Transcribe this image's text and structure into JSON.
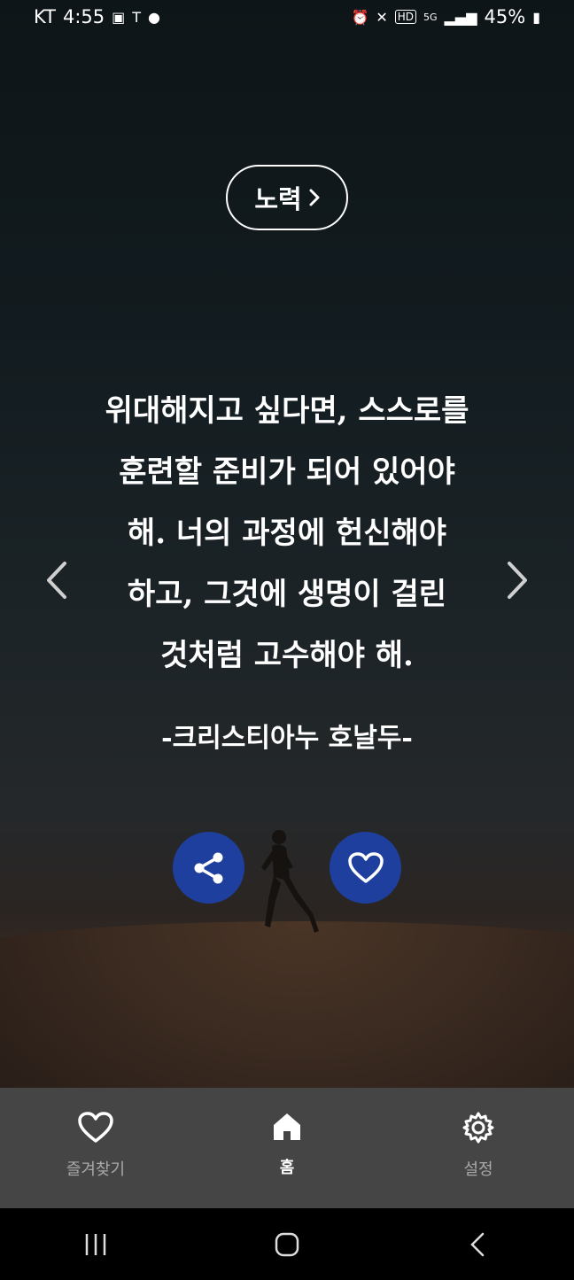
{
  "status_bar": {
    "carrier": "KT",
    "time": "4:55",
    "battery_percent": "45%",
    "network": "5G"
  },
  "category": {
    "label": "노력",
    "chevron": "›"
  },
  "quote": {
    "lines": [
      "위대해지고 싶다면, 스스로를",
      "훈련할 준비가 되어 있어야",
      "해. 너의 과정에 헌신해야",
      "하고, 그것에 생명이 걸린",
      "것처럼 고수해야 해."
    ],
    "author": "-크리스티아누 호날두-"
  },
  "actions": {
    "share_icon": "share-icon",
    "favorite_icon": "heart-icon",
    "accent_color": "#1f3f9e"
  },
  "bottom_nav": {
    "items": [
      {
        "label": "즐겨찾기",
        "icon": "heart-outline-icon",
        "active": false
      },
      {
        "label": "홈",
        "icon": "home-icon",
        "active": true
      },
      {
        "label": "설정",
        "icon": "gear-icon",
        "active": false
      }
    ]
  },
  "system_nav": {
    "recents": "recents-icon",
    "home": "home-circle-icon",
    "back": "back-icon"
  }
}
